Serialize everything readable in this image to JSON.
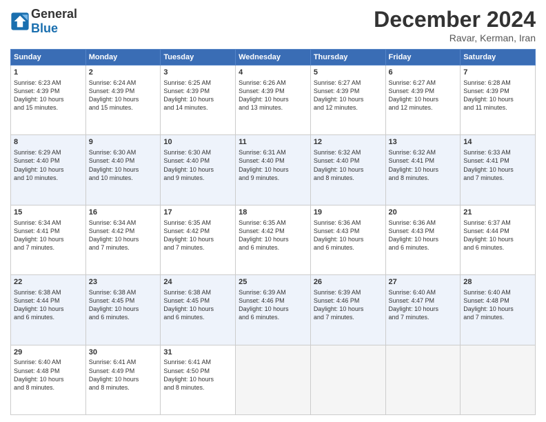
{
  "header": {
    "logo_general": "General",
    "logo_blue": "Blue",
    "month_title": "December 2024",
    "subtitle": "Ravar, Kerman, Iran"
  },
  "weekdays": [
    "Sunday",
    "Monday",
    "Tuesday",
    "Wednesday",
    "Thursday",
    "Friday",
    "Saturday"
  ],
  "rows": [
    [
      {
        "day": "1",
        "lines": [
          "Sunrise: 6:23 AM",
          "Sunset: 4:39 PM",
          "Daylight: 10 hours",
          "and 15 minutes."
        ]
      },
      {
        "day": "2",
        "lines": [
          "Sunrise: 6:24 AM",
          "Sunset: 4:39 PM",
          "Daylight: 10 hours",
          "and 15 minutes."
        ]
      },
      {
        "day": "3",
        "lines": [
          "Sunrise: 6:25 AM",
          "Sunset: 4:39 PM",
          "Daylight: 10 hours",
          "and 14 minutes."
        ]
      },
      {
        "day": "4",
        "lines": [
          "Sunrise: 6:26 AM",
          "Sunset: 4:39 PM",
          "Daylight: 10 hours",
          "and 13 minutes."
        ]
      },
      {
        "day": "5",
        "lines": [
          "Sunrise: 6:27 AM",
          "Sunset: 4:39 PM",
          "Daylight: 10 hours",
          "and 12 minutes."
        ]
      },
      {
        "day": "6",
        "lines": [
          "Sunrise: 6:27 AM",
          "Sunset: 4:39 PM",
          "Daylight: 10 hours",
          "and 12 minutes."
        ]
      },
      {
        "day": "7",
        "lines": [
          "Sunrise: 6:28 AM",
          "Sunset: 4:39 PM",
          "Daylight: 10 hours",
          "and 11 minutes."
        ]
      }
    ],
    [
      {
        "day": "8",
        "lines": [
          "Sunrise: 6:29 AM",
          "Sunset: 4:40 PM",
          "Daylight: 10 hours",
          "and 10 minutes."
        ]
      },
      {
        "day": "9",
        "lines": [
          "Sunrise: 6:30 AM",
          "Sunset: 4:40 PM",
          "Daylight: 10 hours",
          "and 10 minutes."
        ]
      },
      {
        "day": "10",
        "lines": [
          "Sunrise: 6:30 AM",
          "Sunset: 4:40 PM",
          "Daylight: 10 hours",
          "and 9 minutes."
        ]
      },
      {
        "day": "11",
        "lines": [
          "Sunrise: 6:31 AM",
          "Sunset: 4:40 PM",
          "Daylight: 10 hours",
          "and 9 minutes."
        ]
      },
      {
        "day": "12",
        "lines": [
          "Sunrise: 6:32 AM",
          "Sunset: 4:40 PM",
          "Daylight: 10 hours",
          "and 8 minutes."
        ]
      },
      {
        "day": "13",
        "lines": [
          "Sunrise: 6:32 AM",
          "Sunset: 4:41 PM",
          "Daylight: 10 hours",
          "and 8 minutes."
        ]
      },
      {
        "day": "14",
        "lines": [
          "Sunrise: 6:33 AM",
          "Sunset: 4:41 PM",
          "Daylight: 10 hours",
          "and 7 minutes."
        ]
      }
    ],
    [
      {
        "day": "15",
        "lines": [
          "Sunrise: 6:34 AM",
          "Sunset: 4:41 PM",
          "Daylight: 10 hours",
          "and 7 minutes."
        ]
      },
      {
        "day": "16",
        "lines": [
          "Sunrise: 6:34 AM",
          "Sunset: 4:42 PM",
          "Daylight: 10 hours",
          "and 7 minutes."
        ]
      },
      {
        "day": "17",
        "lines": [
          "Sunrise: 6:35 AM",
          "Sunset: 4:42 PM",
          "Daylight: 10 hours",
          "and 7 minutes."
        ]
      },
      {
        "day": "18",
        "lines": [
          "Sunrise: 6:35 AM",
          "Sunset: 4:42 PM",
          "Daylight: 10 hours",
          "and 6 minutes."
        ]
      },
      {
        "day": "19",
        "lines": [
          "Sunrise: 6:36 AM",
          "Sunset: 4:43 PM",
          "Daylight: 10 hours",
          "and 6 minutes."
        ]
      },
      {
        "day": "20",
        "lines": [
          "Sunrise: 6:36 AM",
          "Sunset: 4:43 PM",
          "Daylight: 10 hours",
          "and 6 minutes."
        ]
      },
      {
        "day": "21",
        "lines": [
          "Sunrise: 6:37 AM",
          "Sunset: 4:44 PM",
          "Daylight: 10 hours",
          "and 6 minutes."
        ]
      }
    ],
    [
      {
        "day": "22",
        "lines": [
          "Sunrise: 6:38 AM",
          "Sunset: 4:44 PM",
          "Daylight: 10 hours",
          "and 6 minutes."
        ]
      },
      {
        "day": "23",
        "lines": [
          "Sunrise: 6:38 AM",
          "Sunset: 4:45 PM",
          "Daylight: 10 hours",
          "and 6 minutes."
        ]
      },
      {
        "day": "24",
        "lines": [
          "Sunrise: 6:38 AM",
          "Sunset: 4:45 PM",
          "Daylight: 10 hours",
          "and 6 minutes."
        ]
      },
      {
        "day": "25",
        "lines": [
          "Sunrise: 6:39 AM",
          "Sunset: 4:46 PM",
          "Daylight: 10 hours",
          "and 6 minutes."
        ]
      },
      {
        "day": "26",
        "lines": [
          "Sunrise: 6:39 AM",
          "Sunset: 4:46 PM",
          "Daylight: 10 hours",
          "and 7 minutes."
        ]
      },
      {
        "day": "27",
        "lines": [
          "Sunrise: 6:40 AM",
          "Sunset: 4:47 PM",
          "Daylight: 10 hours",
          "and 7 minutes."
        ]
      },
      {
        "day": "28",
        "lines": [
          "Sunrise: 6:40 AM",
          "Sunset: 4:48 PM",
          "Daylight: 10 hours",
          "and 7 minutes."
        ]
      }
    ],
    [
      {
        "day": "29",
        "lines": [
          "Sunrise: 6:40 AM",
          "Sunset: 4:48 PM",
          "Daylight: 10 hours",
          "and 8 minutes."
        ]
      },
      {
        "day": "30",
        "lines": [
          "Sunrise: 6:41 AM",
          "Sunset: 4:49 PM",
          "Daylight: 10 hours",
          "and 8 minutes."
        ]
      },
      {
        "day": "31",
        "lines": [
          "Sunrise: 6:41 AM",
          "Sunset: 4:50 PM",
          "Daylight: 10 hours",
          "and 8 minutes."
        ]
      },
      null,
      null,
      null,
      null
    ]
  ]
}
